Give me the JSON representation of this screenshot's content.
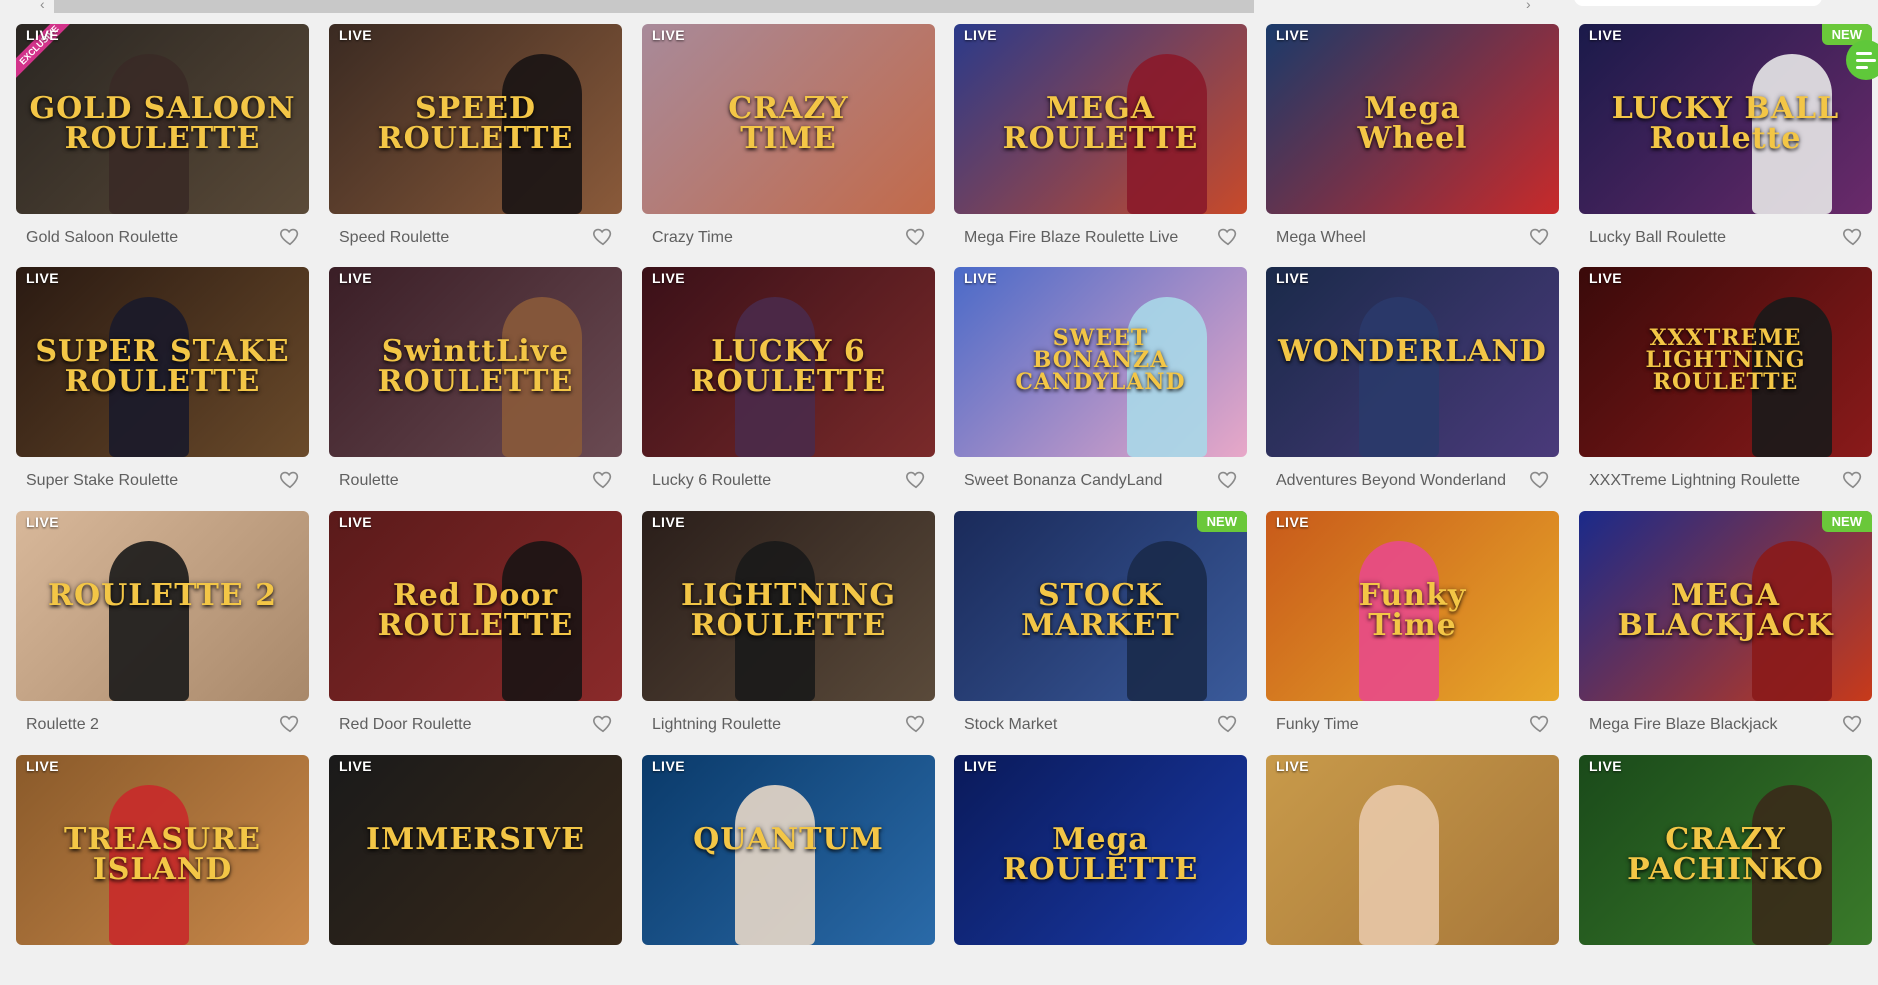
{
  "topbar": {
    "left_arrow": "‹",
    "right_arrow": "›"
  },
  "games": [
    {
      "title": "Gold Saloon Roulette",
      "badge": "LIVE",
      "exclusive": "EXCLUSIVE",
      "logo": "GOLD SALOON\nROULETTE",
      "bg": [
        "#2a2622",
        "#5a4a38"
      ],
      "fig": "#3a2a26"
    },
    {
      "title": "Speed Roulette",
      "badge": "LIVE",
      "logo": "SPEED\nROULETTE",
      "bg": [
        "#3a2a22",
        "#8a5a3a"
      ],
      "fig": "#1a1414"
    },
    {
      "title": "Crazy Time",
      "badge": "LIVE",
      "logo": "CRAZY\nTIME",
      "bg": [
        "#a88a9a",
        "#c26a4a"
      ],
      "fig": ""
    },
    {
      "title": "Mega Fire Blaze Roulette Live",
      "badge": "LIVE",
      "logo": "MEGA\nROULETTE",
      "bg": [
        "#2a3a8a",
        "#c84a2a"
      ],
      "fig": "#8a1a2a"
    },
    {
      "title": "Mega Wheel",
      "badge": "LIVE",
      "logo": "Mega\nWheel",
      "bg": [
        "#1a3a6a",
        "#c82a2a"
      ],
      "fig": ""
    },
    {
      "title": "Lucky Ball Roulette",
      "badge": "LIVE",
      "new": "NEW",
      "logo": "LUCKY BALL\nRoulette",
      "bg": [
        "#1a1a4a",
        "#6a2a6a"
      ],
      "fig": "#e8e8e8"
    },
    {
      "title": "Super Stake Roulette",
      "badge": "LIVE",
      "logo": "SUPER STAKE\nROULETTE",
      "bg": [
        "#2a1a12",
        "#6a4a2a"
      ],
      "fig": "#1a1a2a"
    },
    {
      "title": "Roulette",
      "badge": "LIVE",
      "logo": "SwinttLive\nROULETTE",
      "bg": [
        "#3a1e26",
        "#6a4a52"
      ],
      "fig": "#8a5a3a"
    },
    {
      "title": "Lucky 6 Roulette",
      "badge": "LIVE",
      "logo": "LUCKY 6\nROULETTE",
      "bg": [
        "#3a1018",
        "#7a2a2a"
      ],
      "fig": "#4a2a4a"
    },
    {
      "title": "Sweet Bonanza CandyLand",
      "badge": "LIVE",
      "logo": "SWEET\nBONANZA\nCANDYLAND",
      "bg": [
        "#4a6ac8",
        "#e8a8c8"
      ],
      "fig": "#a8d8e8"
    },
    {
      "title": "Adventures Beyond Wonderland",
      "badge": "LIVE",
      "logo": "WONDERLAND",
      "bg": [
        "#1a2a4a",
        "#4a3a7a"
      ],
      "fig": "#2a3a6a"
    },
    {
      "title": "XXXTreme Lightning Roulette",
      "badge": "LIVE",
      "logo": "XXXTREME\nLIGHTNING\nROULETTE",
      "bg": [
        "#3a0a0a",
        "#8a1a1a"
      ],
      "fig": "#1a1a1a"
    },
    {
      "title": "Roulette 2",
      "badge": "LIVE",
      "logo": "ROULETTE 2",
      "bg": [
        "#d8b89a",
        "#a8886a"
      ],
      "fig": "#1a1a1a"
    },
    {
      "title": "Red Door Roulette",
      "badge": "LIVE",
      "logo": "Red Door\nROULETTE",
      "bg": [
        "#5a1a1a",
        "#8a2a2a"
      ],
      "fig": "#1a1414"
    },
    {
      "title": "Lightning Roulette",
      "badge": "LIVE",
      "logo": "LIGHTNING\nROULETTE",
      "bg": [
        "#2a1e1a",
        "#5a4a3a"
      ],
      "fig": "#1a1a1a"
    },
    {
      "title": "Stock Market",
      "badge": "",
      "new": "NEW",
      "logo": "STOCK\nMARKET",
      "bg": [
        "#1a2a5a",
        "#3a5a9a"
      ],
      "fig": "#1a2a4a"
    },
    {
      "title": "Funky Time",
      "badge": "LIVE",
      "logo": "Funky\nTime",
      "bg": [
        "#c85a1a",
        "#e8a82a"
      ],
      "fig": "#e84a8a"
    },
    {
      "title": "Mega Fire Blaze Blackjack",
      "badge": "",
      "new": "NEW",
      "logo": "MEGA\nBLACKJACK",
      "bg": [
        "#1a2a8a",
        "#c83a1a"
      ],
      "fig": "#8a1a1a"
    },
    {
      "title": "",
      "badge": "LIVE",
      "logo": "TREASURE\nISLAND",
      "bg": [
        "#8a5a2a",
        "#c8884a"
      ],
      "fig": "#c82a2a"
    },
    {
      "title": "",
      "badge": "LIVE",
      "logo": "IMMERSIVE",
      "bg": [
        "#1a1a1a",
        "#3a2a1a"
      ],
      "fig": ""
    },
    {
      "title": "",
      "badge": "LIVE",
      "logo": "QUANTUM",
      "bg": [
        "#0a3a6a",
        "#2a6aa8"
      ],
      "fig": "#e8d8c8"
    },
    {
      "title": "",
      "badge": "LIVE",
      "logo": "Mega\nROULETTE",
      "bg": [
        "#0a1a5a",
        "#1a3aa8"
      ],
      "fig": ""
    },
    {
      "title": "",
      "badge": "LIVE",
      "logo": "",
      "bg": [
        "#c89a4a",
        "#a8783a"
      ],
      "fig": "#e8c8a8"
    },
    {
      "title": "",
      "badge": "LIVE",
      "logo": "CRAZY\nPACHINKO",
      "bg": [
        "#1a4a1a",
        "#3a7a2a"
      ],
      "fig": "#3a2a1a"
    }
  ]
}
